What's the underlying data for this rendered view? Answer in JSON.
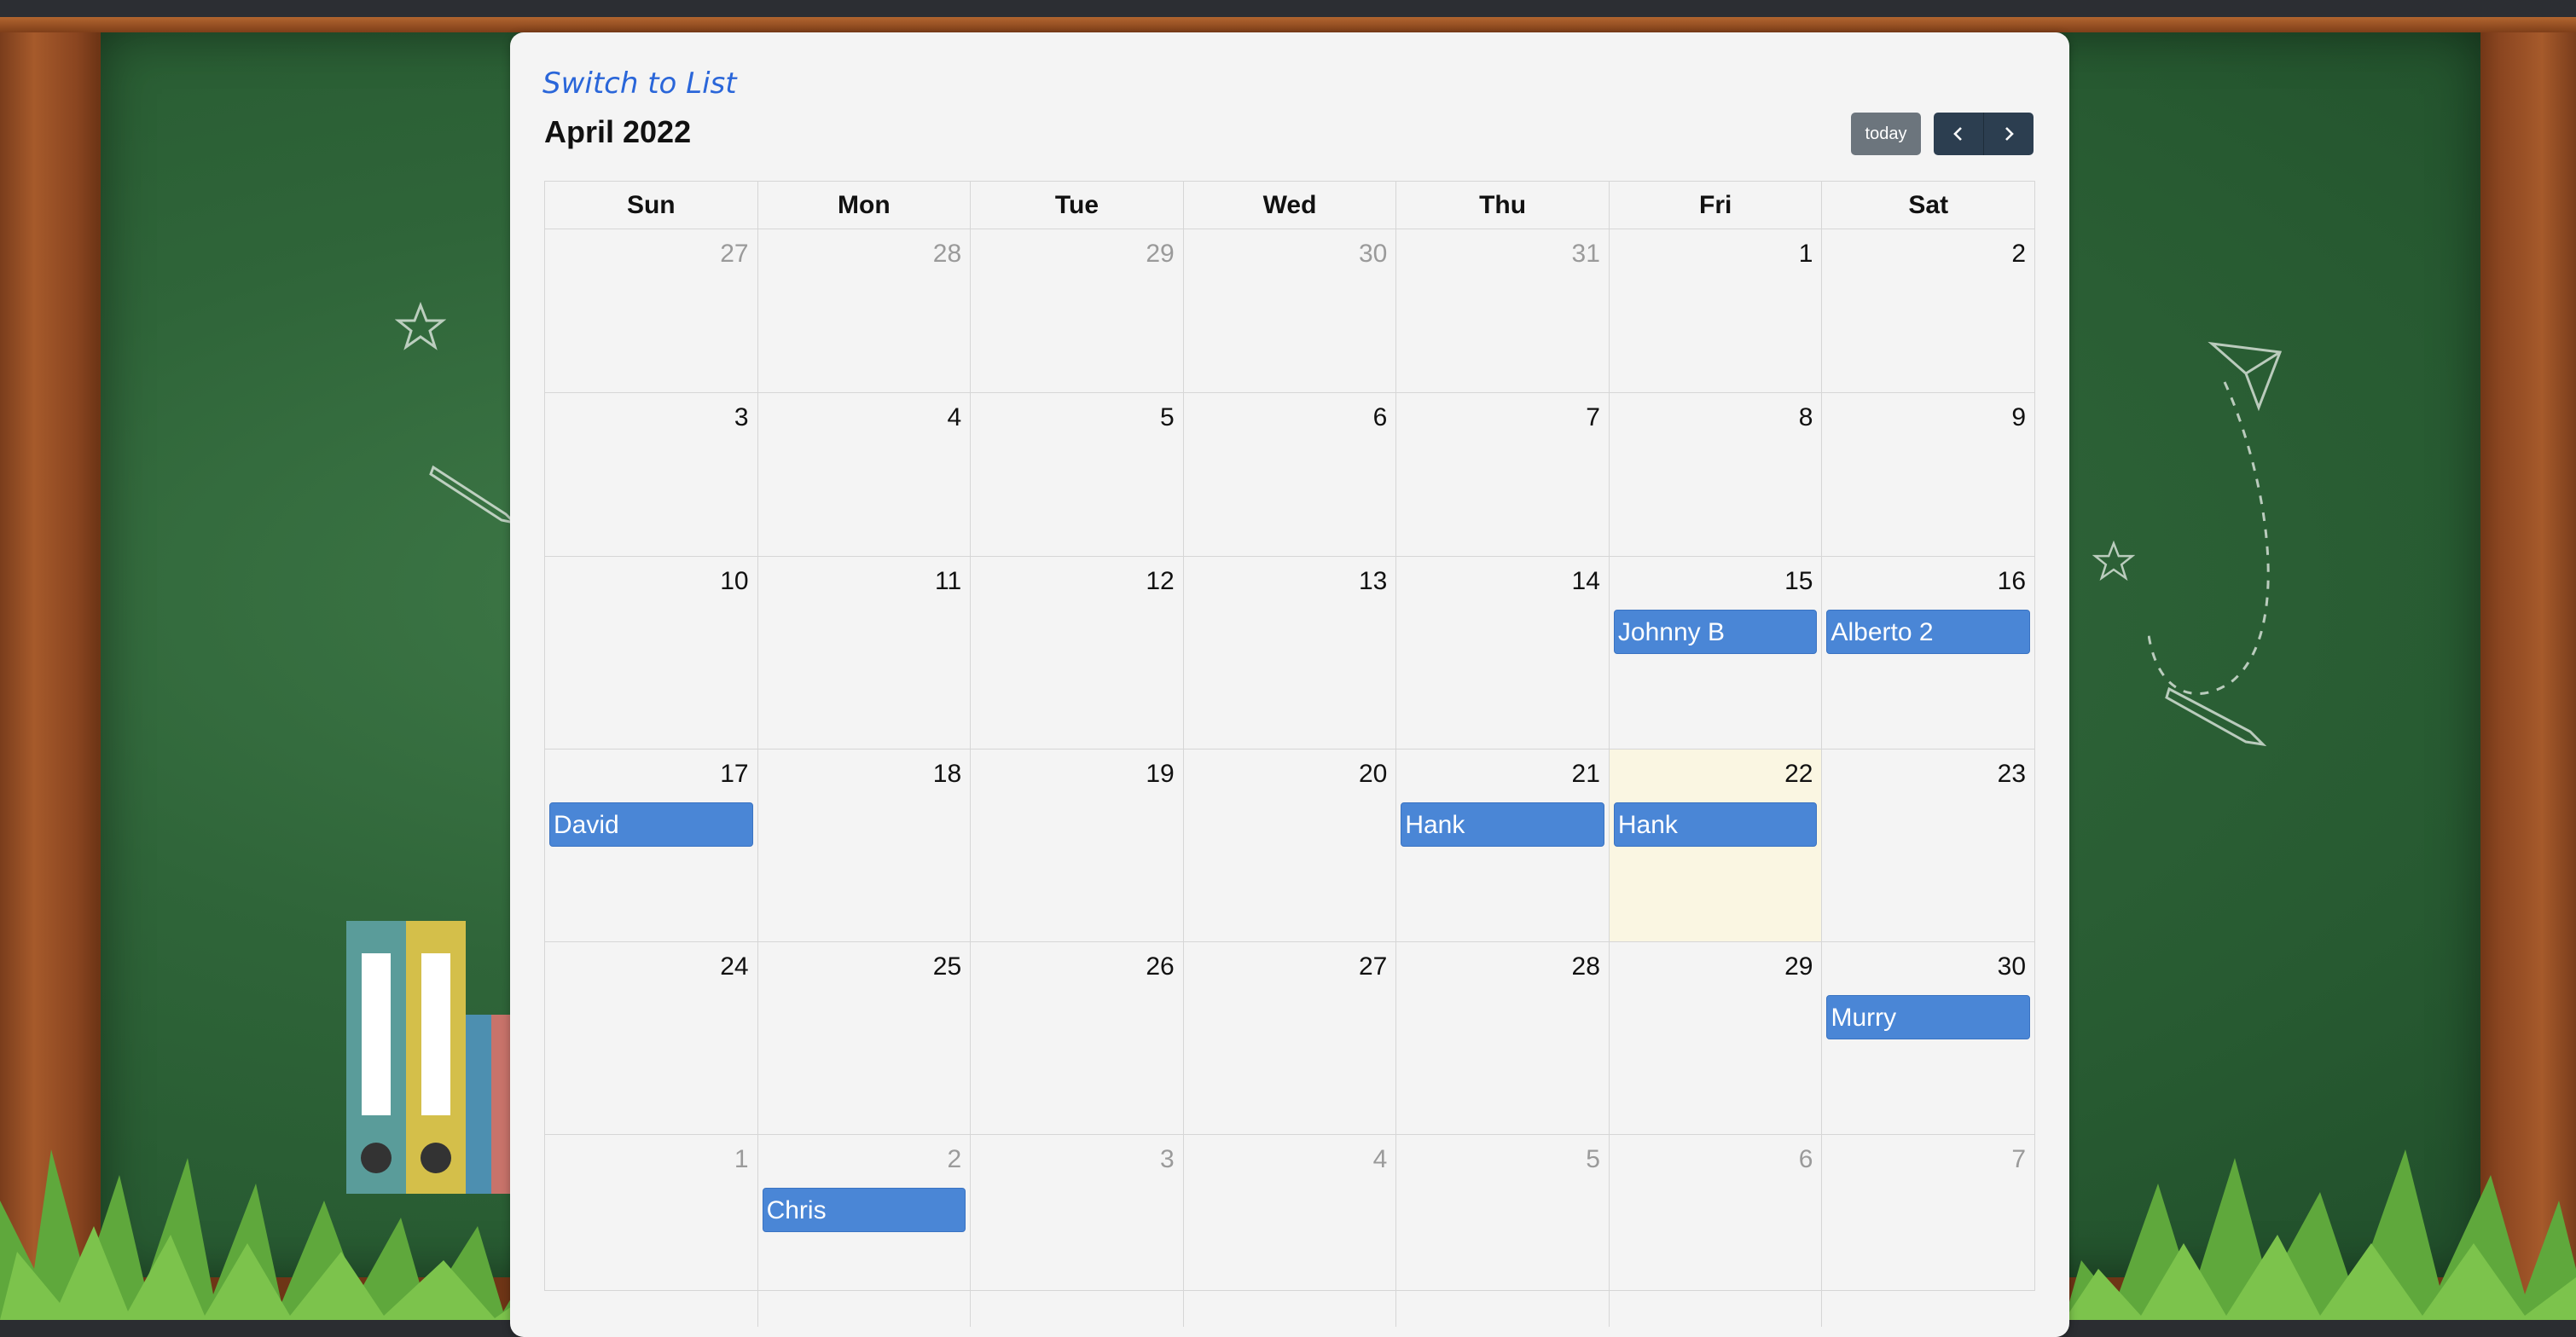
{
  "header": {
    "switch_label": "Switch to List",
    "month_title": "April 2022",
    "today_label": "today",
    "prev_icon": "chevron-left-icon",
    "next_icon": "chevron-right-icon"
  },
  "weekdays": [
    "Sun",
    "Mon",
    "Tue",
    "Wed",
    "Thu",
    "Fri",
    "Sat"
  ],
  "weeks": [
    [
      {
        "d": "27",
        "o": true
      },
      {
        "d": "28",
        "o": true
      },
      {
        "d": "29",
        "o": true
      },
      {
        "d": "30",
        "o": true
      },
      {
        "d": "31",
        "o": true
      },
      {
        "d": "1"
      },
      {
        "d": "2"
      }
    ],
    [
      {
        "d": "3"
      },
      {
        "d": "4"
      },
      {
        "d": "5"
      },
      {
        "d": "6"
      },
      {
        "d": "7"
      },
      {
        "d": "8"
      },
      {
        "d": "9"
      }
    ],
    [
      {
        "d": "10"
      },
      {
        "d": "11"
      },
      {
        "d": "12"
      },
      {
        "d": "13"
      },
      {
        "d": "14"
      },
      {
        "d": "15",
        "e": "Johnny B"
      },
      {
        "d": "16",
        "e": "Alberto 2"
      }
    ],
    [
      {
        "d": "17",
        "e": "David"
      },
      {
        "d": "18"
      },
      {
        "d": "19"
      },
      {
        "d": "20"
      },
      {
        "d": "21",
        "e": "Hank"
      },
      {
        "d": "22",
        "e": "Hank",
        "t": true
      },
      {
        "d": "23"
      }
    ],
    [
      {
        "d": "24"
      },
      {
        "d": "25"
      },
      {
        "d": "26"
      },
      {
        "d": "27"
      },
      {
        "d": "28"
      },
      {
        "d": "29"
      },
      {
        "d": "30",
        "e": "Murry"
      }
    ],
    [
      {
        "d": "1",
        "o": true
      },
      {
        "d": "2",
        "o": true,
        "e": "Chris"
      },
      {
        "d": "3",
        "o": true
      },
      {
        "d": "4",
        "o": true
      },
      {
        "d": "5",
        "o": true
      },
      {
        "d": "6",
        "o": true
      },
      {
        "d": "7",
        "o": true
      }
    ]
  ],
  "colors": {
    "event": "#4a86d6",
    "today": "#faf6e2",
    "link": "#2a66d9",
    "nav": "#2c3e50"
  }
}
